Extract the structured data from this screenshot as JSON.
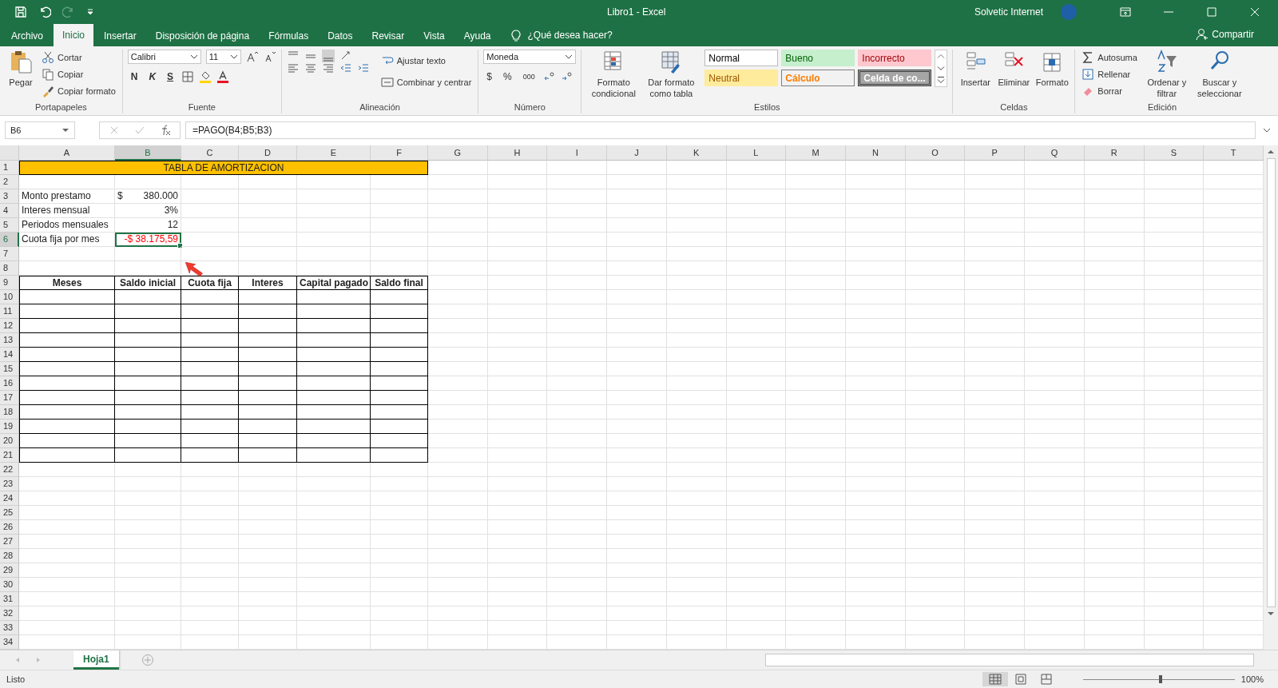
{
  "title_bar": {
    "document_title": "Libro1  -  Excel",
    "user": "Solvetic Internet"
  },
  "menu_tabs": [
    {
      "label": "Archivo",
      "selected": false
    },
    {
      "label": "Inicio",
      "selected": true
    },
    {
      "label": "Insertar",
      "selected": false
    },
    {
      "label": "Disposición de página",
      "selected": false
    },
    {
      "label": "Fórmulas",
      "selected": false
    },
    {
      "label": "Datos",
      "selected": false
    },
    {
      "label": "Revisar",
      "selected": false
    },
    {
      "label": "Vista",
      "selected": false
    },
    {
      "label": "Ayuda",
      "selected": false
    }
  ],
  "tell_me": "¿Qué desea hacer?",
  "share": "Compartir",
  "ribbon": {
    "clipboard": {
      "paste": "Pegar",
      "cut": "Cortar",
      "copy": "Copiar",
      "format_painter": "Copiar formato",
      "label": "Portapapeles"
    },
    "font": {
      "name": "Calibri",
      "size": "11",
      "bold": "N",
      "italic": "K",
      "underline": "S",
      "label": "Fuente"
    },
    "alignment": {
      "wrap": "Ajustar texto",
      "merge": "Combinar y centrar",
      "label": "Alineación"
    },
    "number": {
      "format": "Moneda",
      "currency": "$",
      "percent": "%",
      "thousands": "000",
      "label": "Número"
    },
    "styles": {
      "conditional": "Formato condicional",
      "as_table": "Dar formato como tabla",
      "label": "Estilos",
      "gallery": [
        {
          "text": "Normal",
          "kind": "normal"
        },
        {
          "text": "Bueno",
          "kind": "good"
        },
        {
          "text": "Incorrecto",
          "kind": "bad"
        },
        {
          "text": "Neutral",
          "kind": "neutral"
        },
        {
          "text": "Cálculo",
          "kind": "calculation"
        },
        {
          "text": "Celda de co...",
          "kind": "check"
        }
      ]
    },
    "cells": {
      "insert": "Insertar",
      "delete": "Eliminar",
      "format": "Formato",
      "label": "Celdas"
    },
    "editing": {
      "autosum": "Autosuma",
      "fill": "Rellenar",
      "clear": "Borrar",
      "sort": "Ordenar y filtrar",
      "find": "Buscar y seleccionar",
      "label": "Edición"
    }
  },
  "formula_bar": {
    "name_box": "B6",
    "formula": "=PAGO(B4;B5;B3)"
  },
  "sheet": {
    "columns": [
      "A",
      "B",
      "C",
      "D",
      "E",
      "F",
      "G",
      "H",
      "I",
      "J",
      "K",
      "L",
      "M",
      "N",
      "O",
      "P",
      "Q",
      "R",
      "S",
      "T"
    ],
    "rows": [
      {
        "number": "1",
        "kind": "plain",
        "cells": [
          {
            "text": "TABLA DE AMORTIZACION",
            "kind": "banner",
            "selected": false
          }
        ]
      },
      {
        "number": "2",
        "kind": "plain"
      },
      {
        "number": "3",
        "kind": "plain",
        "cells": [
          {
            "text": "Monto prestamo",
            "kind": "label",
            "selected": false
          },
          {
            "symbol": "$",
            "text": "380.000",
            "kind": "currency",
            "selected": false
          }
        ]
      },
      {
        "number": "4",
        "kind": "plain",
        "cells": [
          {
            "text": "Interes mensual",
            "kind": "label",
            "selected": false
          },
          {
            "text": "3%",
            "kind": "number",
            "selected": false
          }
        ]
      },
      {
        "number": "5",
        "kind": "plain",
        "cells": [
          {
            "text": "Periodos mensuales",
            "kind": "label",
            "selected": false
          },
          {
            "text": "12",
            "kind": "number",
            "selected": false
          }
        ]
      },
      {
        "number": "6",
        "kind": "plain",
        "cells": [
          {
            "text": "Cuota fija por mes",
            "kind": "label",
            "selected": false
          },
          {
            "text": "-$ 38.175,59",
            "kind": "negative",
            "selected": true
          }
        ]
      },
      {
        "number": "7",
        "kind": "plain"
      },
      {
        "number": "8",
        "kind": "plain"
      },
      {
        "number": "9",
        "kind": "table",
        "cells": [
          {
            "text": "Meses",
            "kind": "header",
            "selected": false
          },
          {
            "text": "Saldo inicial",
            "kind": "header",
            "selected": false
          },
          {
            "text": "Cuota fija",
            "kind": "header",
            "selected": false
          },
          {
            "text": "Interes",
            "kind": "header",
            "selected": false
          },
          {
            "text": "Capital pagado",
            "kind": "header",
            "selected": false
          },
          {
            "text": "Saldo final",
            "kind": "header",
            "selected": false
          }
        ]
      },
      {
        "number": "10",
        "kind": "table"
      },
      {
        "number": "11",
        "kind": "table"
      },
      {
        "number": "12",
        "kind": "table"
      },
      {
        "number": "13",
        "kind": "table"
      },
      {
        "number": "14",
        "kind": "table"
      },
      {
        "number": "15",
        "kind": "table"
      },
      {
        "number": "16",
        "kind": "table"
      },
      {
        "number": "17",
        "kind": "table"
      },
      {
        "number": "18",
        "kind": "table"
      },
      {
        "number": "19",
        "kind": "table"
      },
      {
        "number": "20",
        "kind": "table"
      },
      {
        "number": "21",
        "kind": "table"
      },
      {
        "number": "22",
        "kind": "plain"
      },
      {
        "number": "23",
        "kind": "plain"
      },
      {
        "number": "24",
        "kind": "plain"
      },
      {
        "number": "25",
        "kind": "plain"
      },
      {
        "number": "26",
        "kind": "plain"
      },
      {
        "number": "27",
        "kind": "plain"
      },
      {
        "number": "28",
        "kind": "plain"
      },
      {
        "number": "29",
        "kind": "plain"
      },
      {
        "number": "30",
        "kind": "plain"
      },
      {
        "number": "31",
        "kind": "plain"
      },
      {
        "number": "32",
        "kind": "plain"
      },
      {
        "number": "33",
        "kind": "plain"
      },
      {
        "number": "34",
        "kind": "plain"
      }
    ]
  },
  "sheet_tabs": [
    {
      "label": "Hoja1",
      "selected": true
    }
  ],
  "status_bar": {
    "status": "Listo",
    "zoom": "100%",
    "level": 0.5
  }
}
